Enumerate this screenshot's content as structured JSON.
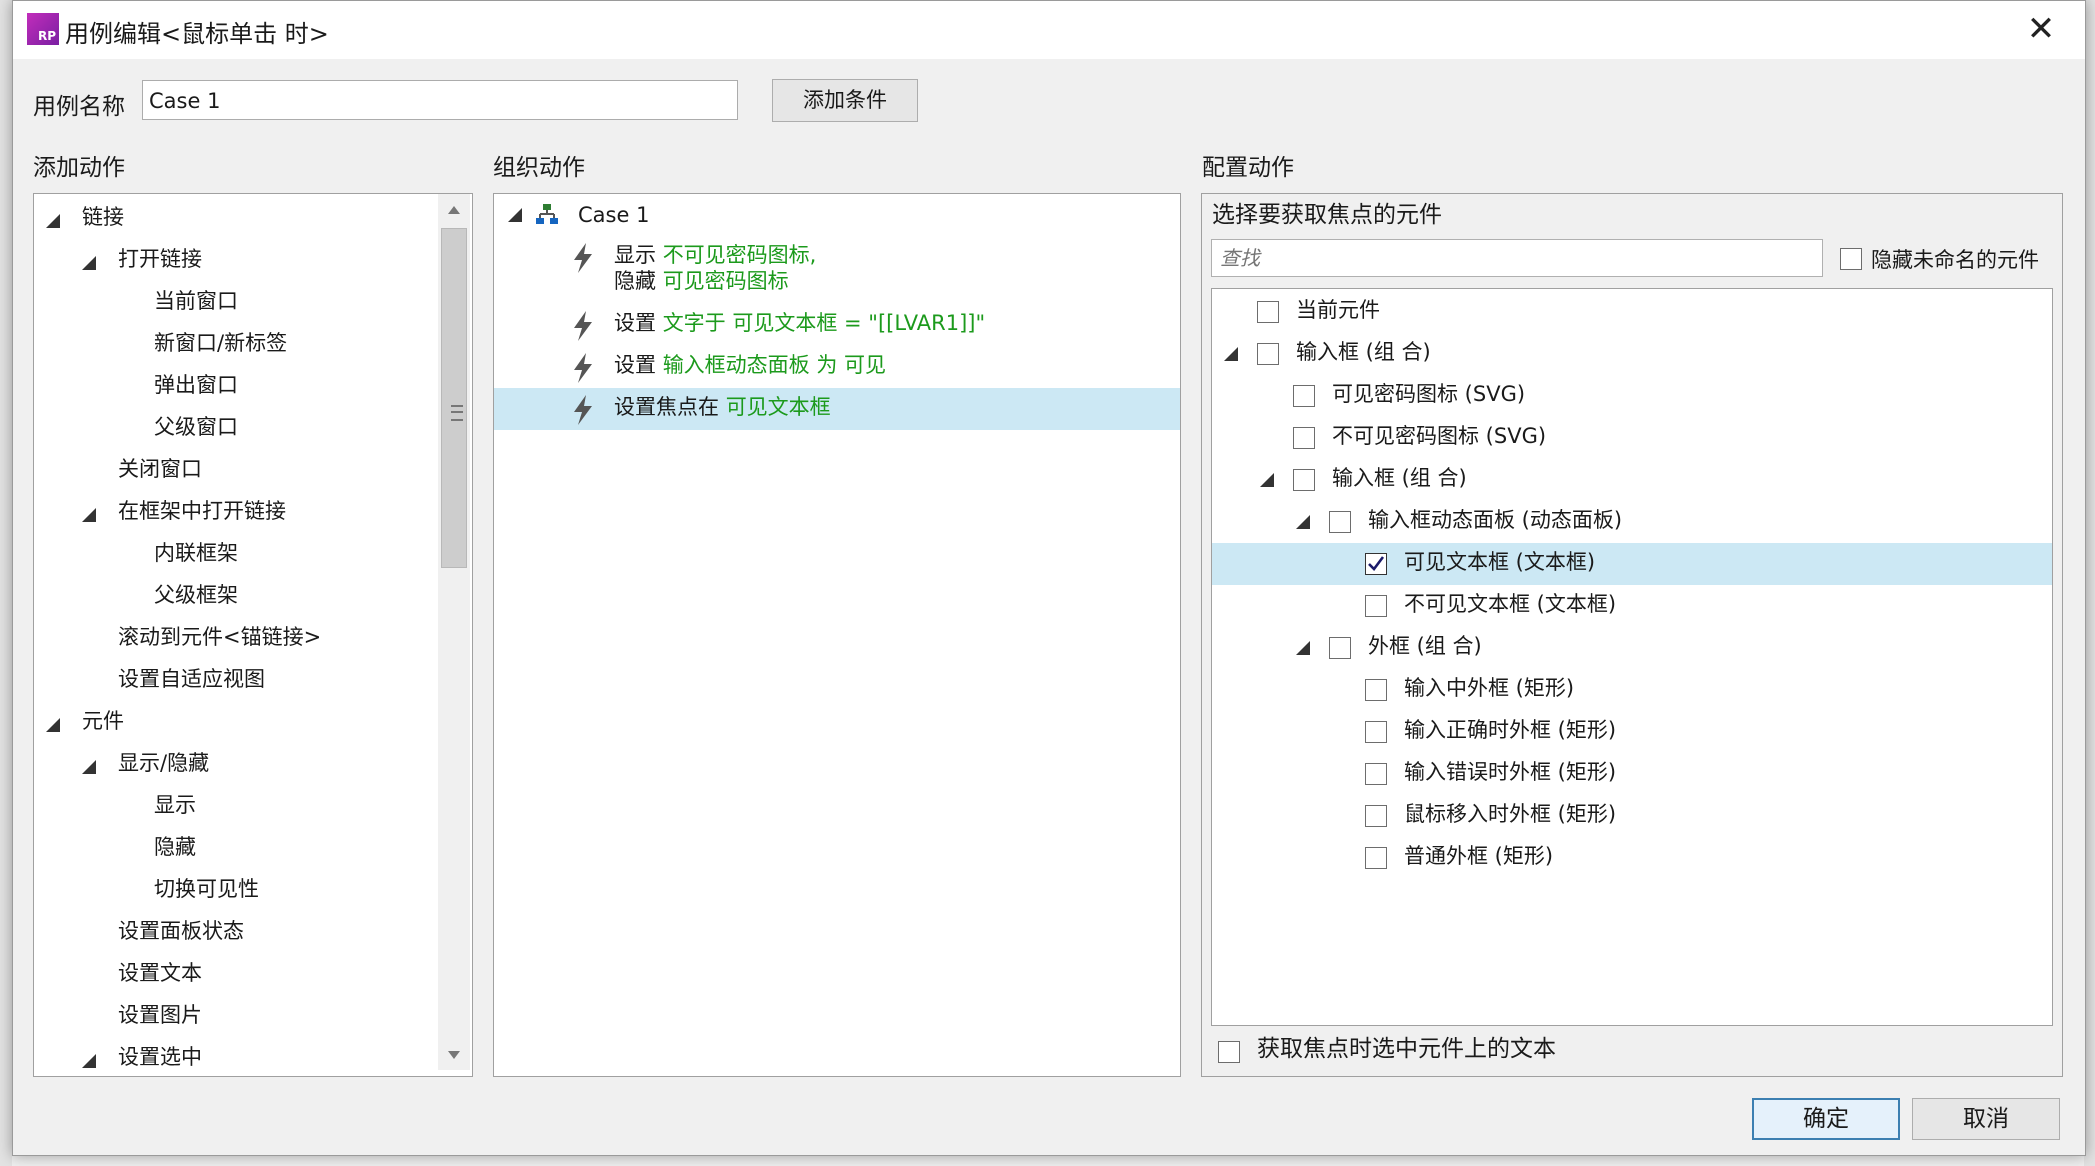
{
  "dialog": {
    "title": "用例编辑<鼠标单击 时>",
    "logo_text": "RP",
    "close_glyph": "✕"
  },
  "case": {
    "name_label": "用例名称",
    "name_value": "Case 1",
    "add_condition_label": "添加条件"
  },
  "add_actions": {
    "heading": "添加动作",
    "items": [
      {
        "label": "链接",
        "level": 0,
        "expandable": true
      },
      {
        "label": "打开链接",
        "level": 1,
        "expandable": true
      },
      {
        "label": "当前窗口",
        "level": 2,
        "expandable": false
      },
      {
        "label": "新窗口/新标签",
        "level": 2,
        "expandable": false
      },
      {
        "label": "弹出窗口",
        "level": 2,
        "expandable": false
      },
      {
        "label": "父级窗口",
        "level": 2,
        "expandable": false
      },
      {
        "label": "关闭窗口",
        "level": 1,
        "expandable": false
      },
      {
        "label": "在框架中打开链接",
        "level": 1,
        "expandable": true
      },
      {
        "label": "内联框架",
        "level": 2,
        "expandable": false
      },
      {
        "label": "父级框架",
        "level": 2,
        "expandable": false
      },
      {
        "label": "滚动到元件<锚链接>",
        "level": 1,
        "expandable": false
      },
      {
        "label": "设置自适应视图",
        "level": 1,
        "expandable": false
      },
      {
        "label": "元件",
        "level": 0,
        "expandable": true
      },
      {
        "label": "显示/隐藏",
        "level": 1,
        "expandable": true
      },
      {
        "label": "显示",
        "level": 2,
        "expandable": false
      },
      {
        "label": "隐藏",
        "level": 2,
        "expandable": false
      },
      {
        "label": "切换可见性",
        "level": 2,
        "expandable": false
      },
      {
        "label": "设置面板状态",
        "level": 1,
        "expandable": false
      },
      {
        "label": "设置文本",
        "level": 1,
        "expandable": false
      },
      {
        "label": "设置图片",
        "level": 1,
        "expandable": false
      },
      {
        "label": "设置选中",
        "level": 1,
        "expandable": true
      }
    ]
  },
  "organize": {
    "heading": "组织动作",
    "case_label": "Case 1",
    "actions": [
      {
        "lines": [
          {
            "prefix": "显示 ",
            "target": "不可见密码图标,"
          },
          {
            "prefix": "隐藏 ",
            "target": "可见密码图标"
          }
        ],
        "selected": false
      },
      {
        "lines": [
          {
            "prefix": "设置 ",
            "target": "文字于 可见文本框 = \"[[LVAR1]]\""
          }
        ],
        "selected": false
      },
      {
        "lines": [
          {
            "prefix": "设置 ",
            "target": "输入框动态面板 为 可见"
          }
        ],
        "selected": false
      },
      {
        "lines": [
          {
            "prefix": "设置焦点在 ",
            "target": "可见文本框"
          }
        ],
        "selected": true
      }
    ]
  },
  "configure": {
    "heading": "配置动作",
    "subheading": "选择要获取焦点的元件",
    "search_placeholder": "查找",
    "hide_unnamed_label": "隐藏未命名的元件",
    "tree": [
      {
        "label": "当前元件",
        "level": 0,
        "expandable": false,
        "checked": false,
        "selected": false
      },
      {
        "label": "输入框 (组 合)",
        "level": 0,
        "expandable": true,
        "checked": false,
        "selected": false
      },
      {
        "label": "可见密码图标 (SVG)",
        "level": 1,
        "expandable": false,
        "checked": false,
        "selected": false
      },
      {
        "label": "不可见密码图标 (SVG)",
        "level": 1,
        "expandable": false,
        "checked": false,
        "selected": false
      },
      {
        "label": "输入框 (组 合)",
        "level": 1,
        "expandable": true,
        "checked": false,
        "selected": false
      },
      {
        "label": "输入框动态面板 (动态面板)",
        "level": 2,
        "expandable": true,
        "checked": false,
        "selected": false
      },
      {
        "label": "可见文本框 (文本框)",
        "level": 3,
        "expandable": false,
        "checked": true,
        "selected": true
      },
      {
        "label": "不可见文本框 (文本框)",
        "level": 3,
        "expandable": false,
        "checked": false,
        "selected": false
      },
      {
        "label": "外框 (组 合)",
        "level": 2,
        "expandable": true,
        "checked": false,
        "selected": false
      },
      {
        "label": "输入中外框 (矩形)",
        "level": 3,
        "expandable": false,
        "checked": false,
        "selected": false
      },
      {
        "label": "输入正确时外框 (矩形)",
        "level": 3,
        "expandable": false,
        "checked": false,
        "selected": false
      },
      {
        "label": "输入错误时外框 (矩形)",
        "level": 3,
        "expandable": false,
        "checked": false,
        "selected": false
      },
      {
        "label": "鼠标移入时外框 (矩形)",
        "level": 3,
        "expandable": false,
        "checked": false,
        "selected": false
      },
      {
        "label": "普通外框 (矩形)",
        "level": 3,
        "expandable": false,
        "checked": false,
        "selected": false
      }
    ],
    "select_text_label": "获取焦点时选中元件上的文本"
  },
  "footer": {
    "ok_label": "确定",
    "cancel_label": "取消"
  },
  "colors": {
    "accent_green": "#1c9a1c",
    "selection": "#cce8f4",
    "primary_border": "#3c7fb1",
    "logo": "#a020b0"
  }
}
